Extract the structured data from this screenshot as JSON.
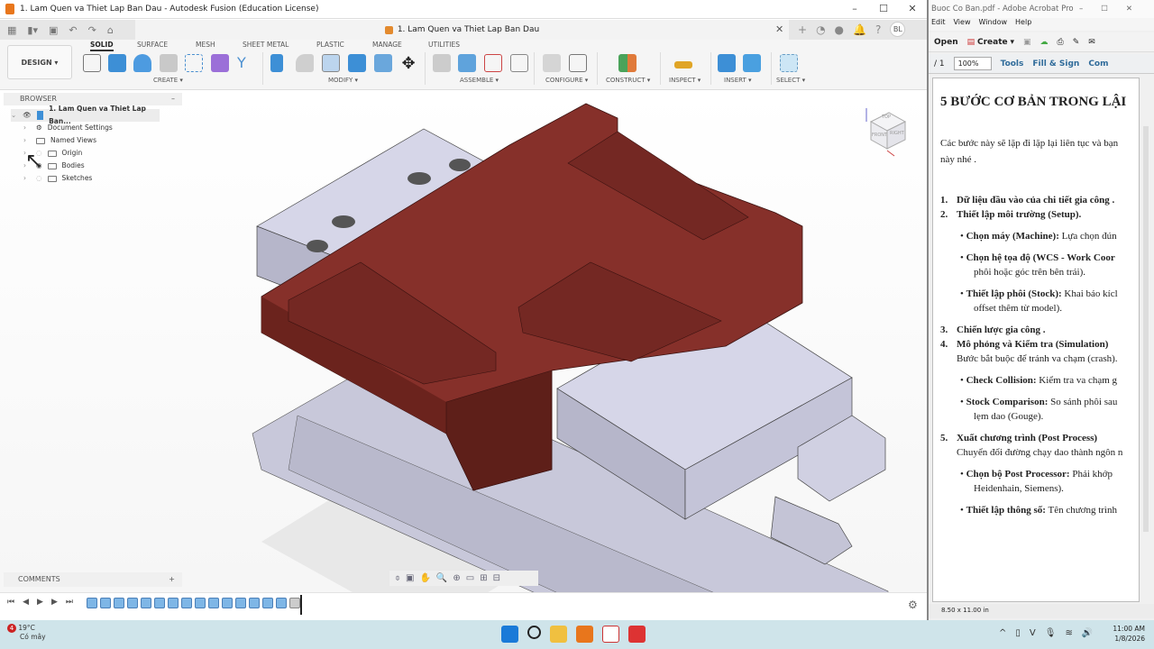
{
  "fusion": {
    "window_title": "1. Lam Quen va Thiet Lap Ban Dau - Autodesk Fusion (Education License)",
    "doc_tab": "1. Lam Quen va Thiet Lap Ban Dau",
    "user_initials": "BL",
    "workspace": "DESIGN",
    "ribbon_tabs": [
      "SOLID",
      "SURFACE",
      "MESH",
      "SHEET METAL",
      "PLASTIC",
      "MANAGE",
      "UTILITIES"
    ],
    "active_tab": "SOLID",
    "groups": [
      "CREATE",
      "MODIFY",
      "ASSEMBLE",
      "CONFIGURE",
      "CONSTRUCT",
      "INSPECT",
      "INSERT",
      "SELECT"
    ],
    "browser": {
      "title": "BROWSER",
      "root": "1. Lam Quen va Thiet Lap Ban...",
      "items": [
        "Document Settings",
        "Named Views",
        "Origin",
        "Bodies",
        "Sketches"
      ]
    },
    "comments": "COMMENTS",
    "viewcube": {
      "top": "TOP",
      "front": "FRONT",
      "right": "RIGHT"
    },
    "accent": "#0696d7",
    "part_color": "#7d2c24"
  },
  "acrobat": {
    "title": "Buoc Co Ban.pdf - Adobe Acrobat Pro",
    "menu": [
      "Edit",
      "View",
      "Window",
      "Help"
    ],
    "open": "Open",
    "create": "Create",
    "page_count": "/ 1",
    "zoom": "100%",
    "tools": "Tools",
    "fill_sign": "Fill & Sign",
    "comment": "Com",
    "page_size": "8.50 x 11.00 in",
    "doc": {
      "heading": "5 BƯỚC CƠ BẢN TRONG LẬI",
      "intro1": "Các bước này sẽ lặp đi lặp lại liên tục và bạn",
      "intro2": "này nhé .",
      "s1": "Dữ liệu đầu vào của chi tiết gia công .",
      "s2": "Thiết lập môi trường (Setup).",
      "b1k": "Chọn máy (Machine):",
      "b1v": " Lựa chọn đún",
      "b2k": "Chọn hệ tọa độ (WCS - Work Coor",
      "b2c": "phôi hoặc góc trên bên trái).",
      "b3k": "Thiết lập phôi (Stock):",
      "b3v": " Khai báo kícl",
      "b3c": "offset thêm từ model).",
      "s3": "Chiến lược gia công .",
      "s4": "Mô phỏng và Kiểm tra (Simulation)",
      "s4d": "Bước bắt buộc để tránh va chạm (crash).",
      "b4k": "Check Collision:",
      "b4v": " Kiểm tra va chạm g",
      "b5k": "Stock Comparison:",
      "b5v": " So sánh phôi sau",
      "b5c": "lẹm dao (Gouge).",
      "s5": "Xuất chương trình (Post Process)",
      "s5d": "Chuyển đổi đường chạy dao thành ngôn n",
      "b6k": "Chọn bộ Post Processor:",
      "b6v": " Phải khớp ",
      "b6c": "Heidenhain, Siemens).",
      "b7k": "Thiết lập thông số:",
      "b7v": " Tên chương trình"
    }
  },
  "taskbar": {
    "temp": "19°C",
    "weather": "Có mây",
    "badge": "4",
    "time": "11:00 AM",
    "date": "1/8/2026"
  }
}
